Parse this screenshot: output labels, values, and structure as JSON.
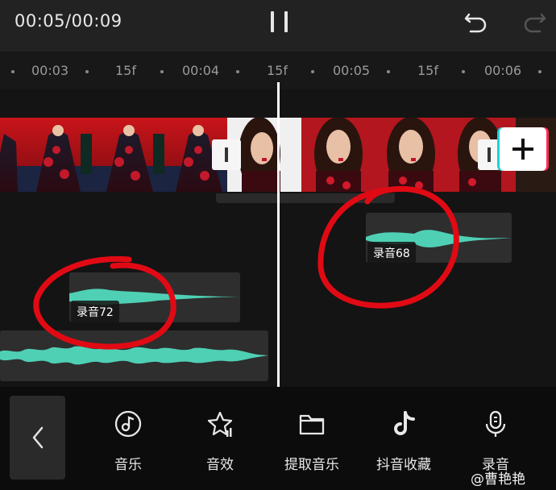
{
  "topbar": {
    "time": "00:05/00:09",
    "pause_icon": "pause-icon",
    "undo_icon": "undo-icon",
    "redo_icon": "redo-icon"
  },
  "ruler": {
    "ticks": [
      "00:03",
      "15f",
      "00:04",
      "15f",
      "00:05",
      "15f",
      "00:06"
    ]
  },
  "audio_tracks": [
    {
      "label": "录音72"
    },
    {
      "label": "录音68"
    }
  ],
  "colors": {
    "waveform": "#4fd0b5",
    "annotation": "#e10a14",
    "accent_cyan": "#1fd1d1",
    "accent_pink": "#ff2d55"
  },
  "toolbar": {
    "back_icon": "chevron-left-icon",
    "items": [
      {
        "label": "音乐",
        "icon": "music-icon"
      },
      {
        "label": "音效",
        "icon": "sound-effect-icon"
      },
      {
        "label": "提取音乐",
        "icon": "extract-folder-icon"
      },
      {
        "label": "抖音收藏",
        "icon": "tiktok-icon"
      },
      {
        "label": "录音",
        "icon": "microphone-icon"
      }
    ]
  },
  "watermark": "@曹艳艳"
}
